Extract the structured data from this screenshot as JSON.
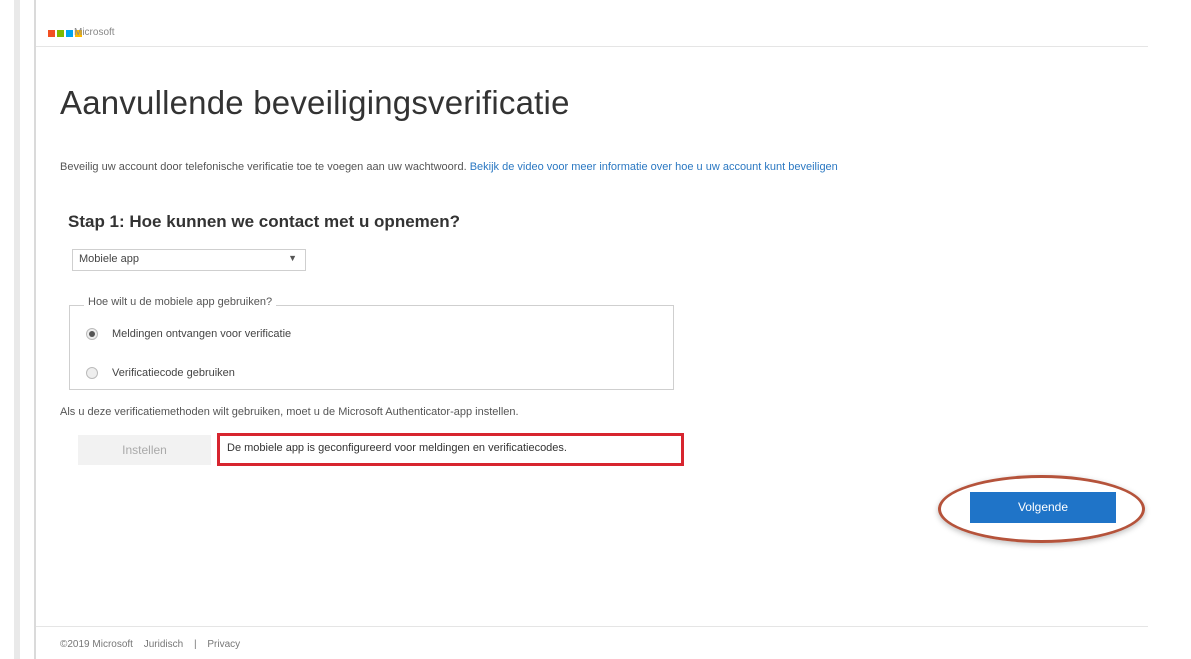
{
  "header": {
    "brand": "Microsoft",
    "logo_colors": [
      "#f25022",
      "#7fba00",
      "#00a4ef",
      "#ffb900"
    ]
  },
  "page": {
    "title": "Aanvullende beveiligingsverificatie",
    "description": "Beveilig uw account door telefonische verificatie toe te voegen aan uw wachtwoord.",
    "description_link": "Bekijk de video voor meer informatie over hoe u uw account kunt beveiligen"
  },
  "step1": {
    "heading": "Stap 1: Hoe kunnen we contact met u opnemen?",
    "method_select": "Mobiele app",
    "usage_legend": "Hoe wilt u de mobiele app gebruiken?",
    "options": [
      {
        "label": "Meldingen ontvangen voor verificatie",
        "checked": true
      },
      {
        "label": "Verificatiecode gebruiken",
        "checked": false
      }
    ],
    "info": "Als u deze verificatiemethoden wilt gebruiken, moet u de Microsoft Authenticator-app instellen.",
    "setup_button": "Instellen",
    "status": "De mobiele app is geconfigureerd voor meldingen en verificatiecodes."
  },
  "actions": {
    "next_button": "Volgende"
  },
  "footer": {
    "copyright": "©2019 Microsoft",
    "legal": "Juridisch",
    "separator": "|",
    "privacy": "Privacy"
  },
  "colors": {
    "accent": "#1f74c8",
    "highlight_box": "#d7252f",
    "annotation_ring": "#b5533b"
  }
}
